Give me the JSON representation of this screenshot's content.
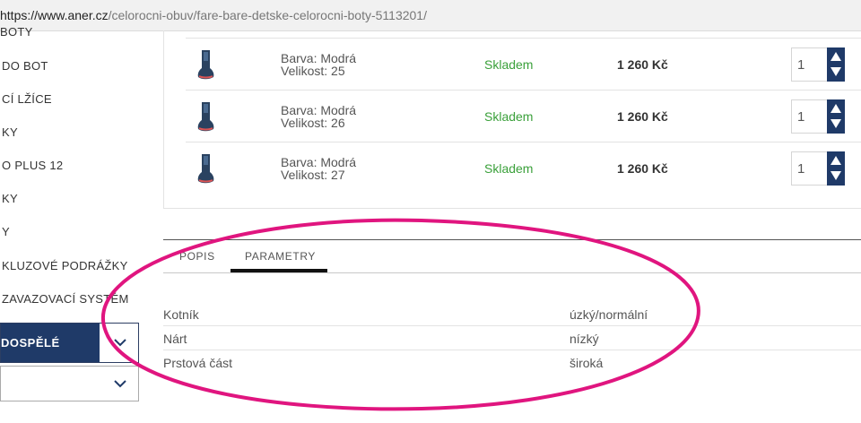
{
  "browser": {
    "url_host": "https://www.aner.cz",
    "url_path": "/celorocni-obuv/fare-bare-detske-celorocni-boty-5113201/"
  },
  "sidebar": {
    "items": [
      {
        "label": "BOTY"
      },
      {
        "label": "DO BOT"
      },
      {
        "label": "CÍ LŽÍCE"
      },
      {
        "label": "KY"
      },
      {
        "label": "O PLUS 12"
      },
      {
        "label": "KY"
      },
      {
        "label": "Y"
      },
      {
        "label": "KLUZOVÉ PODRÁŽKY"
      },
      {
        "label": "ZAVAZOVACÍ SYSTÉM"
      }
    ],
    "category_button": "DOSPĚLÉ"
  },
  "variants": [
    {
      "color_label": "Barva: Modrá",
      "size_label": "Velikost: 25",
      "stock": "Skladem",
      "price": "1 260 Kč",
      "qty": "1"
    },
    {
      "color_label": "Barva: Modrá",
      "size_label": "Velikost: 26",
      "stock": "Skladem",
      "price": "1 260 Kč",
      "qty": "1"
    },
    {
      "color_label": "Barva: Modrá",
      "size_label": "Velikost: 27",
      "stock": "Skladem",
      "price": "1 260 Kč",
      "qty": "1"
    }
  ],
  "tabs": [
    {
      "label": "POPIS",
      "active": false
    },
    {
      "label": "PARAMETRY",
      "active": true
    }
  ],
  "parameters": [
    {
      "name": "Kotník",
      "value": "úzký/normální"
    },
    {
      "name": "Nárt",
      "value": "nízký"
    },
    {
      "name": "Prstová část",
      "value": "široká"
    }
  ],
  "colors": {
    "accent_navy": "#1f3a68",
    "stock_green": "#3aa03a",
    "highlight_magenta": "#e0157f"
  },
  "icons": {
    "chevron": "chevron-down-icon",
    "stepper_up": "triangle-up-icon",
    "stepper_down": "triangle-down-icon",
    "thumb": "shoe-thumbnail"
  }
}
